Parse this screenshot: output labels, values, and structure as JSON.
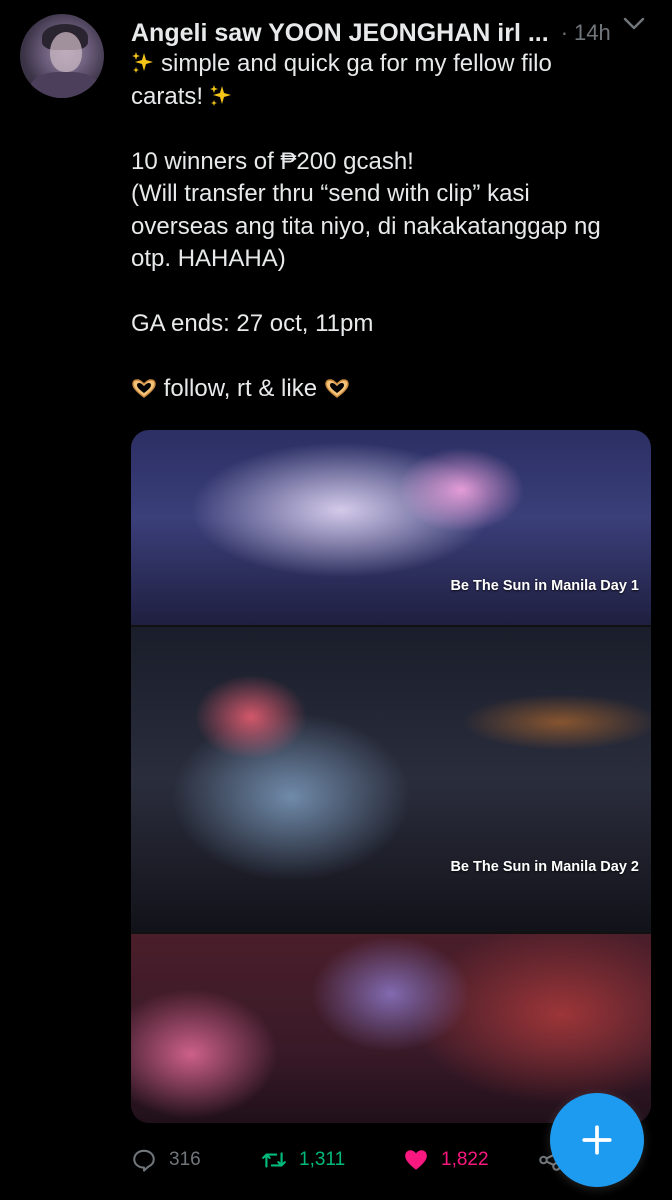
{
  "post": {
    "author_name": "Angeli saw YOON JEONGHAN irl ...",
    "separator": "·",
    "time": "14h",
    "line1_text": "simple and quick ga for my fellow filo",
    "line2_text": "carats!",
    "line3": "10 winners of ₱200 gcash!",
    "line4": "(Will transfer thru “send with clip” kasi",
    "line5": "overseas ang tita niyo, di nakakatanggap ng",
    "line6": "otp. HAHAHA)",
    "line7": "GA ends: 27 oct, 11pm",
    "line8_text": "follow, rt & like"
  },
  "media": {
    "captions": [
      "Be The Sun in Manila Day 1",
      "Be The Sun in Manila Day 2"
    ]
  },
  "actions": {
    "replies": "316",
    "retweets": "1,311",
    "likes": "1,822"
  },
  "icons": {
    "more": "more-options-icon",
    "sparkle": "sparkles-emoji-icon",
    "heart": "heart-hands-emoji-icon",
    "reply": "reply-icon",
    "retweet": "retweet-icon",
    "like": "heart-icon",
    "share": "share-icon",
    "compose": "plus-icon"
  },
  "colors": {
    "background": "#000000",
    "text": "#e7e9ea",
    "muted": "#71767b",
    "retweet": "#00ba7c",
    "like": "#f91880",
    "accent": "#1d9bf0"
  }
}
